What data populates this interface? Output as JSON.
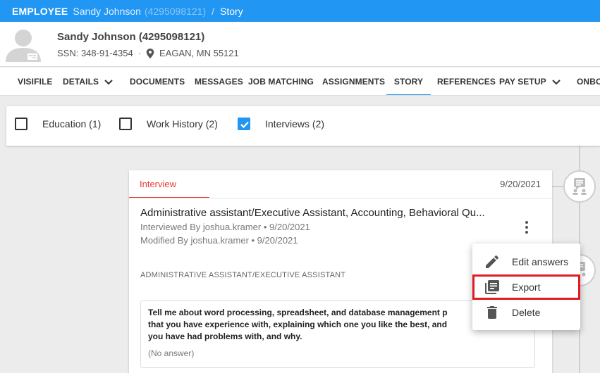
{
  "breadcrumb": {
    "root": "EMPLOYEE",
    "name": "Sandy Johnson",
    "id": "(4295098121)",
    "separator": "/",
    "page": "Story"
  },
  "profile": {
    "name": "Sandy Johnson (4295098121)",
    "ssn": "SSN: 348-91-4354",
    "dot": "·",
    "location": "EAGAN, MN 55121"
  },
  "nav": {
    "tabs": [
      {
        "label": "VISIFILE"
      },
      {
        "label": "DETAILS"
      },
      {
        "label": "DOCUMENTS"
      },
      {
        "label": "MESSAGES"
      },
      {
        "label": "JOB MATCHING"
      },
      {
        "label": "ASSIGNMENTS"
      },
      {
        "label": "STORY"
      },
      {
        "label": "REFERENCES"
      },
      {
        "label": "PAY SETUP"
      },
      {
        "label": "ONBO"
      }
    ],
    "active": "STORY"
  },
  "filters": [
    {
      "label": "Education (1)",
      "checked": false
    },
    {
      "label": "Work History (2)",
      "checked": false
    },
    {
      "label": "Interviews (2)",
      "checked": true
    }
  ],
  "story_card": {
    "tab_label": "Interview",
    "date": "9/20/2021",
    "title": "Administrative assistant/Executive Assistant, Accounting, Behavioral Qu...",
    "interviewed_by": "Interviewed By joshua.kramer • 9/20/2021",
    "modified_by": "Modified By joshua.kramer • 9/20/2021",
    "section_label": "ADMINISTRATIVE ASSISTANT/EXECUTIVE ASSISTANT",
    "question_lines": [
      "Tell me about word processing, spreadsheet, and database management p",
      "that you have experience with, explaining which one you like the best, and",
      "you have had problems with, and why."
    ],
    "answer": "(No answer)"
  },
  "menu": {
    "items": [
      {
        "label": "Edit answers",
        "icon": "pencil-icon"
      },
      {
        "label": "Export",
        "icon": "library-books-icon"
      },
      {
        "label": "Delete",
        "icon": "trash-icon"
      }
    ]
  },
  "colors": {
    "accent": "#2196f3",
    "interview_red": "#e53935",
    "highlight": "#e01b22"
  }
}
